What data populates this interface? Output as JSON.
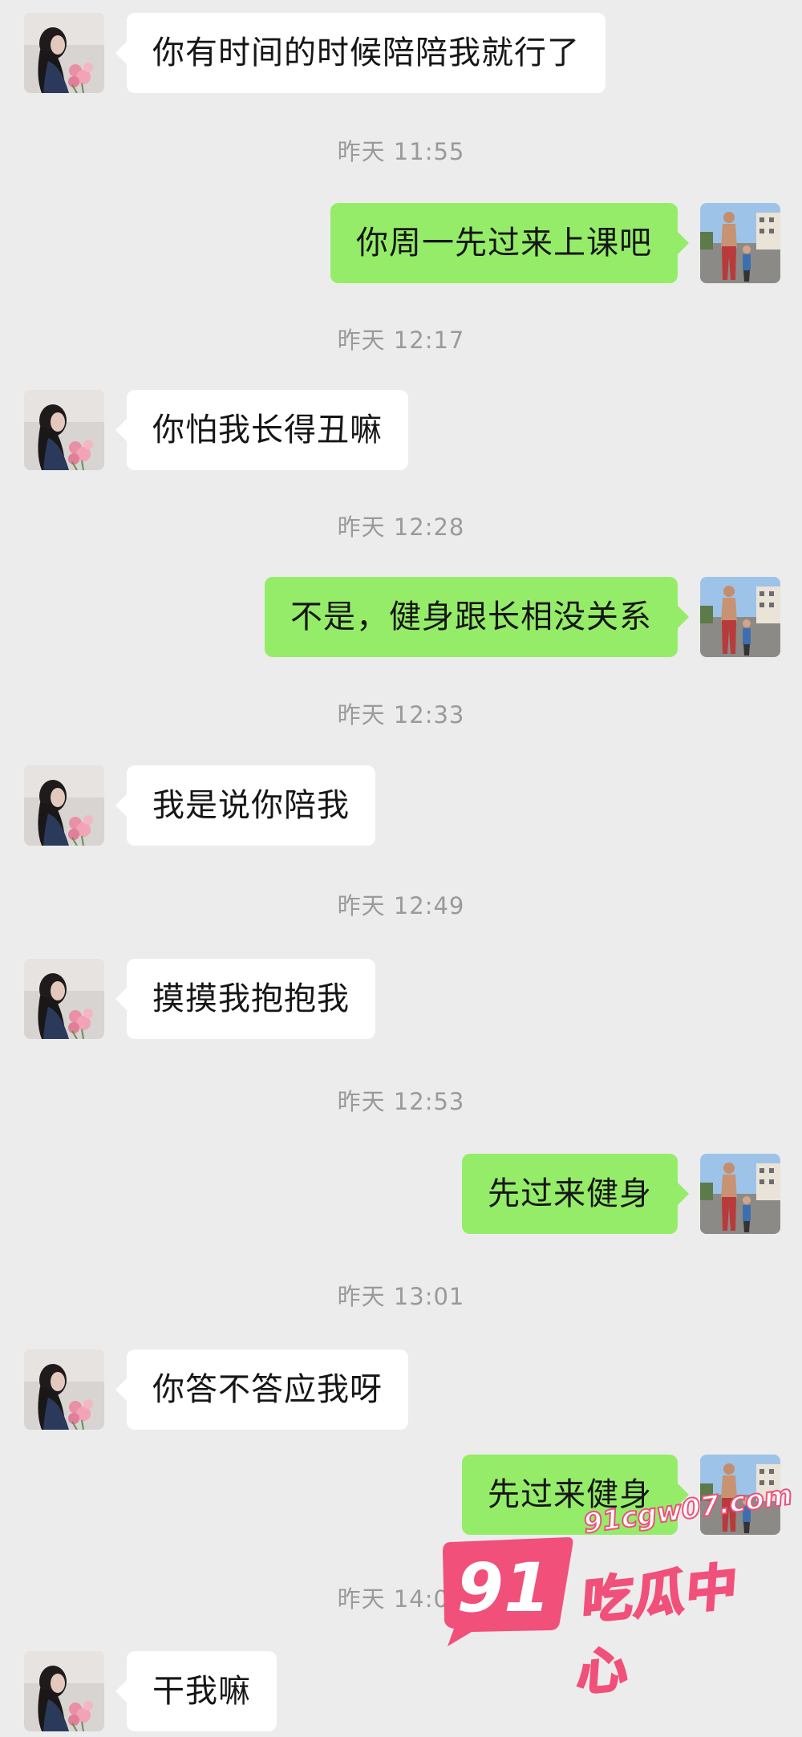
{
  "conversation": {
    "messages": [
      {
        "side": "left",
        "text": "你有时间的时候陪陪我就行了"
      },
      {
        "time": "昨天 11:55"
      },
      {
        "side": "right",
        "text": "你周一先过来上课吧"
      },
      {
        "time": "昨天 12:17"
      },
      {
        "side": "left",
        "text": "你怕我长得丑嘛"
      },
      {
        "time": "昨天 12:28"
      },
      {
        "side": "right",
        "text": "不是，健身跟长相没关系"
      },
      {
        "time": "昨天 12:33"
      },
      {
        "side": "left",
        "text": "我是说你陪我"
      },
      {
        "time": "昨天 12:49"
      },
      {
        "side": "left",
        "text": "摸摸我抱抱我"
      },
      {
        "time": "昨天 12:53"
      },
      {
        "side": "right",
        "text": "先过来健身"
      },
      {
        "time": "昨天 13:01"
      },
      {
        "side": "left",
        "text": "你答不答应我呀"
      },
      {
        "side": "right",
        "text": "先过来健身"
      },
      {
        "time": "昨天 14:00"
      },
      {
        "side": "left",
        "text": "干我嘛"
      }
    ]
  },
  "avatars": {
    "contact": "girl-with-flowers-avatar",
    "self": "man-street-photo-avatar"
  },
  "colors": {
    "background": "#ececec",
    "received_bubble": "#ffffff",
    "sent_bubble": "#95ec69",
    "timestamp_text": "#9a9a9a",
    "watermark_pink": "#f0507a"
  },
  "watermark": {
    "number": "91",
    "url": "91cgw07.com",
    "name": "吃瓜中心"
  }
}
